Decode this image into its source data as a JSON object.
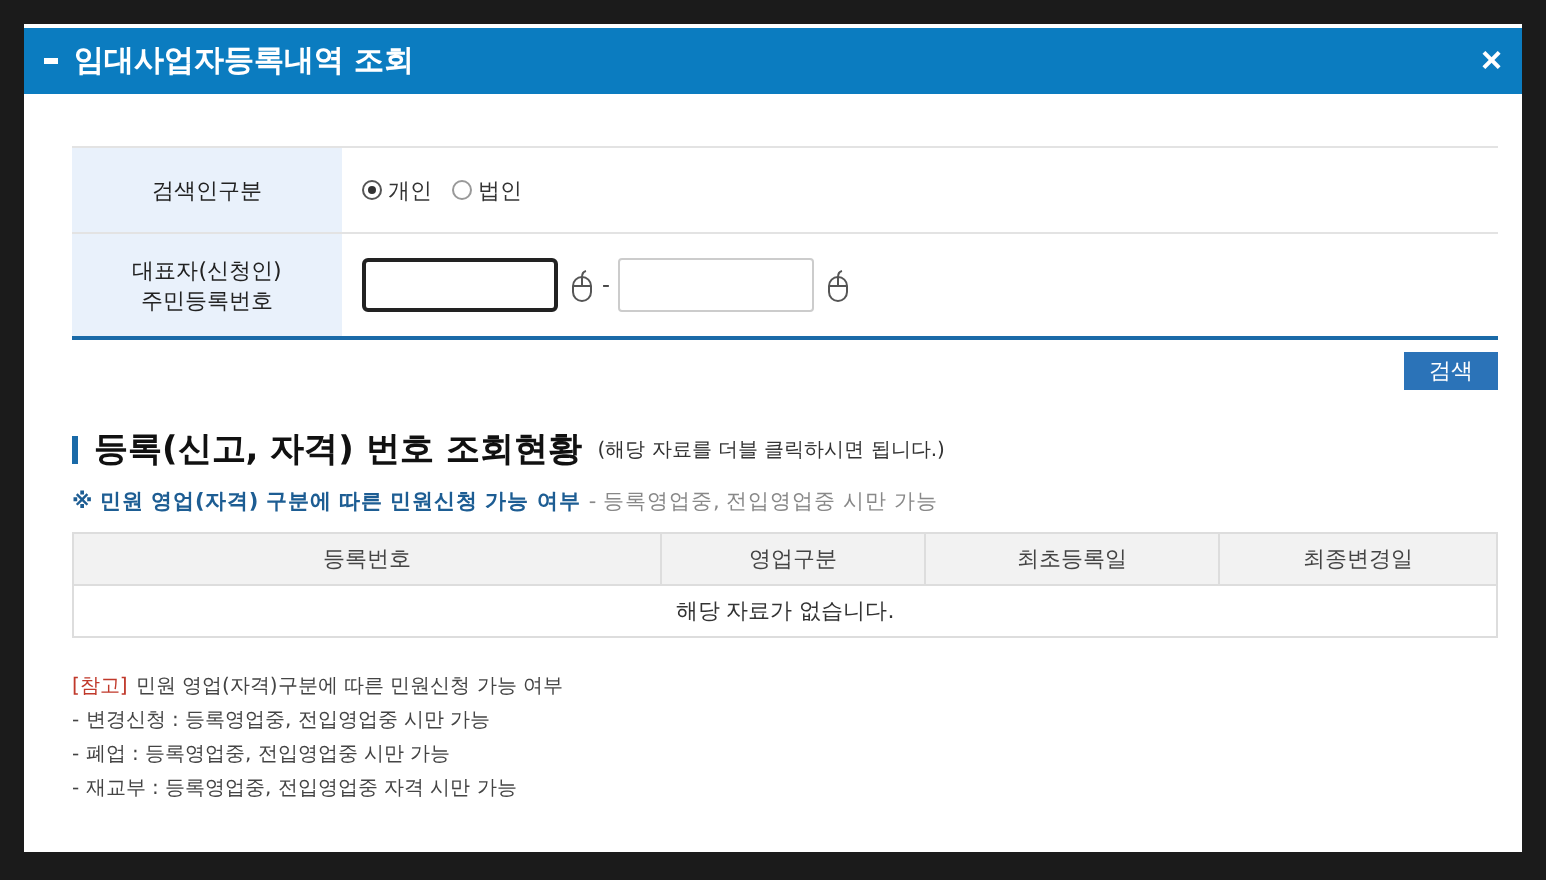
{
  "window": {
    "title": "임대사업자등록내역 조회",
    "close": "×"
  },
  "form": {
    "search_type": {
      "label": "검색인구분",
      "options": [
        {
          "label": "개인",
          "selected": true
        },
        {
          "label": "법인",
          "selected": false
        }
      ]
    },
    "id_number": {
      "label_lines": [
        "대표자(신청인)",
        "주민등록번호"
      ],
      "separator": "-",
      "fields": [
        {
          "focused": true
        },
        {
          "focused": false
        }
      ]
    }
  },
  "search_button": "검색",
  "section": {
    "title": "등록(신고, 자격) 번호 조회현황",
    "hint": "(해당 자료를 더블 클릭하시면 됩니다.)"
  },
  "notice": {
    "title": "※ 민원 영업(자격) 구분에 따른 민원신청 가능 여부",
    "detail": "- 등록영업중, 전입영업중 시만 가능"
  },
  "table": {
    "columns": [
      "등록번호",
      "영업구분",
      "최초등록일",
      "최종변경일"
    ],
    "empty_message": "해당 자료가 없습니다."
  },
  "reference": {
    "tag": "[참고]",
    "text": "민원 영업(자격)구분에 따른 민원신청 가능 여부",
    "lines": [
      "- 변경신청 : 등록영업중, 전입영업중 시만 가능",
      "- 폐업 : 등록영업중, 전입영업중 시만 가능",
      "- 재교부 : 등록영업중, 전입영업중 자격 시만 가능"
    ]
  }
}
